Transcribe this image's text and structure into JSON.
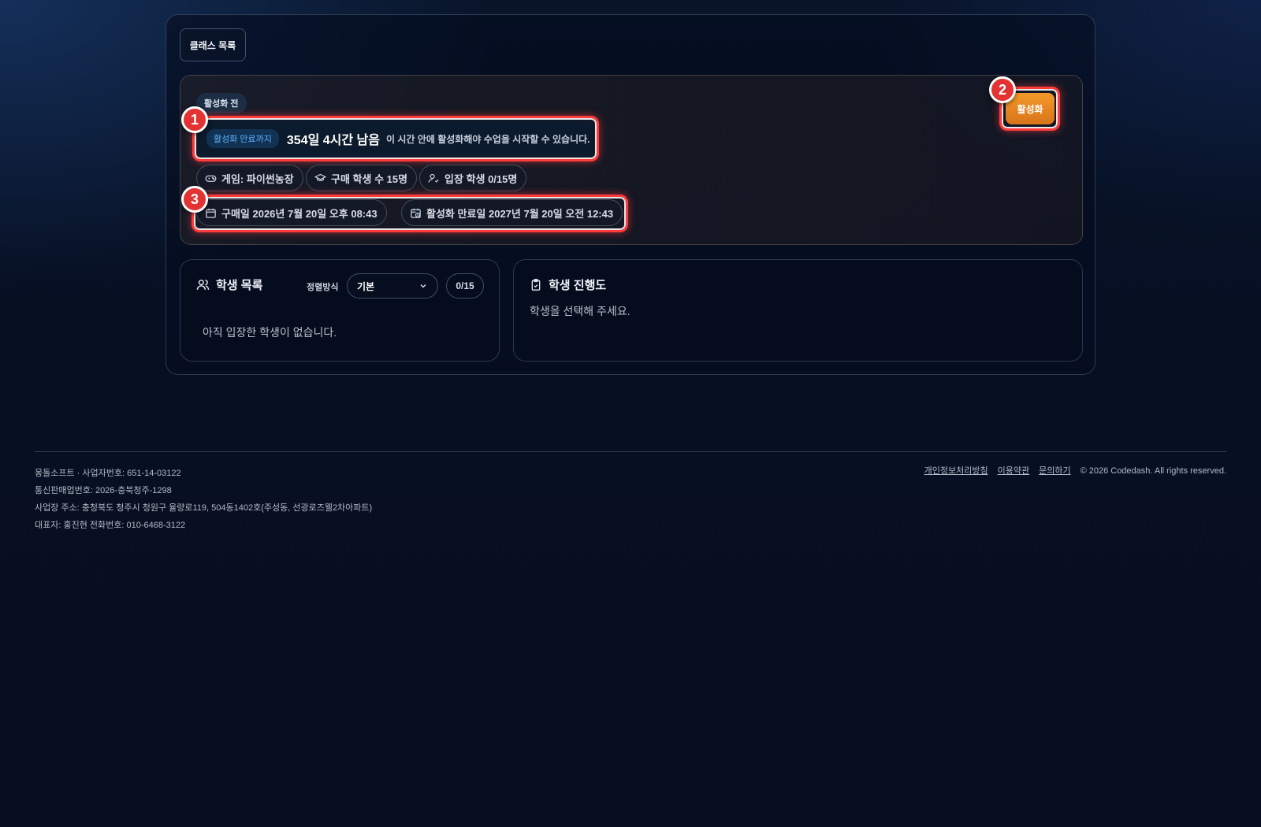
{
  "nav": {
    "back_label": "클래스 목록"
  },
  "class_card": {
    "status": "활성화 전",
    "countdown_tag": "활성화 만료까지",
    "countdown_value": "354일 4시간 남음",
    "countdown_note": "이 시간 안에 활성화해야 수업을 시작할 수 있습니다.",
    "game": "게임: 파이썬농장",
    "purchased_students": "구매 학생 수 15명",
    "entered_students": "입장 학생 0/15명",
    "purchase_date": "구매일 2026년 7월 20일 오후 08:43",
    "expiry_date": "활성화 만료일 2027년 7월 20일 오전 12:43",
    "activate_label": "활성화"
  },
  "markers": [
    "1",
    "2",
    "3"
  ],
  "student_list": {
    "title": "학생 목록",
    "sort_label": "정렬방식",
    "sort_value": "기본",
    "count": "0/15",
    "empty": "아직 입장한 학생이 없습니다."
  },
  "progress": {
    "title": "학생 진행도",
    "hint": "학생을 선택해 주세요."
  },
  "footer": {
    "company": "몽돌소프트 · 사업자번호: 651-14-03122",
    "telecom": "통신판매업번호: 2026-충북청주-1298",
    "address": "사업장 주소: 충청북도 청주시 청원구 율량로119, 504동1402호(주성동, 선광로즈웰2차아파트)",
    "ceo": "대표자: 홍진현 전화번호: 010-6468-3122",
    "links": [
      "개인정보처리방침",
      "이용약관",
      "문의하기"
    ],
    "copyright": "© 2026 Codedash. All rights reserved."
  },
  "colors": {
    "accent_orange": "#f39a2b",
    "highlight_red": "#ff3a3a",
    "tag_blue": "#5fb3ff"
  }
}
